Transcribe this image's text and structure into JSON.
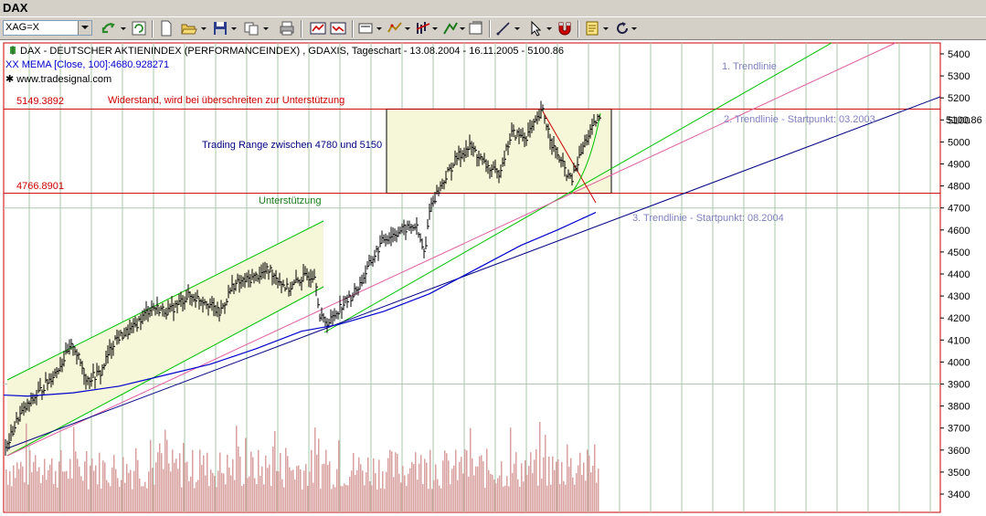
{
  "window": {
    "title": "DAX"
  },
  "toolbar": {
    "symbol_value": "XAG=X"
  },
  "chart": {
    "header": "DAX  - DEUTSCHER AKTIENINDEX (PERFORMANCEINDEX) , GDAXIS, Tageschart - 13.08.2004 - 16.11.2005 - 5100.86",
    "indicator": "XX MEMA [Close, 100]:4680.928271",
    "website": "www.tradesignal.com",
    "annotations": {
      "resistance_value": "5149.3892",
      "resistance_text": "Widerstand, wird bei überschreiten zur Unterstützung",
      "support_value": "4766.8901",
      "support_text": "Unterstützung",
      "range_text": "Trading Range zwischen 4780 und 5150",
      "trend1": "1. Trendlinie",
      "trend2": "2. Trendlinie - Startpunkt: 03.2003",
      "trend3": "3. Trendlinie - Startpunkt: 08.2004"
    },
    "last_price_label": "5100.86",
    "colors": {
      "resistance": "#cc0000",
      "trend_green": "#00c000",
      "trend_pink": "#e060a0",
      "trend_blue": "#000080",
      "mema": "#0000cc",
      "volume": "#d9a0a0"
    }
  },
  "chart_data": {
    "type": "bar",
    "title": "DAX  - DEUTSCHER AKTIENINDEX (PERFORMANCEINDEX) , GDAXIS, Tageschart - 13.08.2004 - 16.11.2005 - 5100.86",
    "y_ticks": [
      3400,
      3500,
      3600,
      3700,
      3800,
      3900,
      4000,
      4100,
      4200,
      4300,
      4400,
      4500,
      4600,
      4700,
      4800,
      4900,
      5000,
      5100,
      5200,
      5300,
      5400
    ],
    "ylim": [
      3320,
      5440
    ],
    "x_range": [
      "13.08.2004",
      "16.11.2005"
    ],
    "series": [
      {
        "name": "DAX",
        "type": "ohlc",
        "close_approx": [
          3650,
          3800,
          3950,
          4050,
          3900,
          4100,
          4200,
          4250,
          4300,
          4250,
          4350,
          4400,
          4350,
          4300,
          4200,
          4300,
          4500,
          4650,
          4700,
          4900,
          5000,
          4950,
          4850,
          4900,
          5050,
          5100,
          4900,
          4800,
          5000,
          5100
        ]
      },
      {
        "name": "XX MEMA [Close, 100]",
        "type": "line",
        "close_approx": [
          3850,
          3860,
          3900,
          3980,
          4060,
          4140,
          4180,
          4260,
          4380,
          4520,
          4620,
          4680
        ]
      }
    ],
    "horizontal_lines": [
      5149.3892,
      4766.8901
    ],
    "trendlines": [
      "1. Trendlinie",
      "2. Trendlinie - Startpunkt: 03.2003",
      "3. Trendlinie - Startpunkt: 08.2004"
    ],
    "last_value": 5100.86
  }
}
